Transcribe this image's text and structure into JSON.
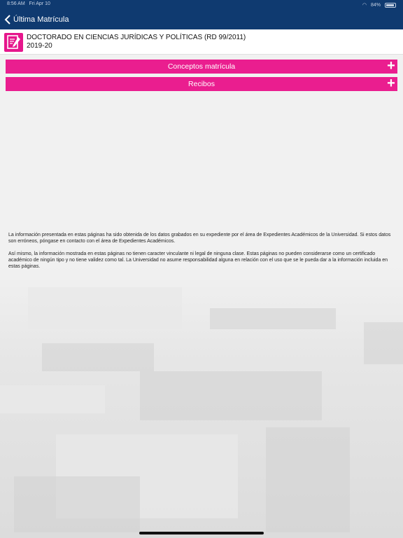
{
  "status_bar": {
    "time": "8:56 AM",
    "date": "Fri Apr 10",
    "battery": "84%"
  },
  "nav": {
    "back_label": "Última Matrícula"
  },
  "header": {
    "title": "DOCTORADO EN CIENCIAS JURÍDICAS Y POLÍTICAS (RD 99/2011)",
    "year": "2019-20",
    "icon": "document-edit-icon"
  },
  "sections": [
    {
      "label": "Conceptos matrícula",
      "icon": "plus-icon"
    },
    {
      "label": "Recibos",
      "icon": "plus-icon"
    }
  ],
  "info": {
    "paragraph1": "La información presentada en estas páginas ha sido obtenida de los datos grabados en su expediente por el área de Expedientes Académicos de la Universidad. Si estos datos son erróneos, póngase en contacto con el área de Expedientes Académicos.",
    "paragraph2": "Así mismo, la información mostrada en estas páginas no tienen caracter vinculante ni legal de ninguna clase. Estas páginas no pueden considerarse como un certificado académico de ningún tipo y no tiene validez como tal. La Universidad no asume responsabilidad alguna en relación con el uso que se le pueda dar a la información incluida en estas páginas."
  },
  "colors": {
    "nav_bar": "#0f3a70",
    "accent": "#ea1e8f"
  }
}
